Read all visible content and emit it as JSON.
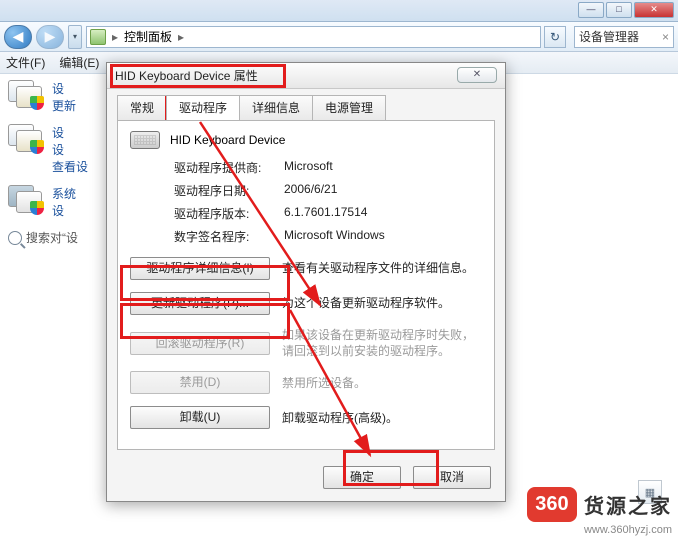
{
  "nav": {
    "breadcrumb": "控制面板",
    "refresh_glyph": "↻",
    "sidebox": "设备管理器",
    "sidebox_x": "×"
  },
  "menu": {
    "file": "文件(F)",
    "edit": "编辑(E)"
  },
  "winbtn": {
    "min": "—",
    "max": "□",
    "close": "✕"
  },
  "cats": {
    "c1t1": "设",
    "c1t2": "更新",
    "c2t1": "设",
    "c2t2": "设",
    "c2sub": "查看设",
    "c3t1": "系统",
    "c3t2": "设"
  },
  "search_label": "搜索对“设",
  "dialog": {
    "title": "HID Keyboard Device 属性",
    "close_glyph": "✕",
    "tabs": {
      "general": "常规",
      "driver": "驱动程序",
      "detail": "详细信息",
      "power": "电源管理"
    },
    "device_name": "HID Keyboard Device",
    "info": {
      "provider_k": "驱动程序提供商:",
      "provider_v": "Microsoft",
      "date_k": "驱动程序日期:",
      "date_v": "2006/6/21",
      "version_k": "驱动程序版本:",
      "version_v": "6.1.7601.17514",
      "signer_k": "数字签名程序:",
      "signer_v": "Microsoft Windows"
    },
    "btn_details": "驱动程序详细信息(I)",
    "desc_details": "查看有关驱动程序文件的详细信息。",
    "btn_update": "更新驱动程序(P)...",
    "desc_update": "为这个设备更新驱动程序软件。",
    "btn_rollback": "回滚驱动程序(R)",
    "desc_rollback": "如果该设备在更新驱动程序时失败，请回滚到以前安装的驱动程序。",
    "btn_disable": "禁用(D)",
    "desc_disable": "禁用所选设备。",
    "btn_uninstall": "卸载(U)",
    "desc_uninstall": "卸载驱动程序(高级)。",
    "ok": "确定",
    "cancel": "取消"
  },
  "brand": {
    "num": "360",
    "cn": "货源之家",
    "url": "www.360hyzj.com"
  },
  "arrow": "▸"
}
